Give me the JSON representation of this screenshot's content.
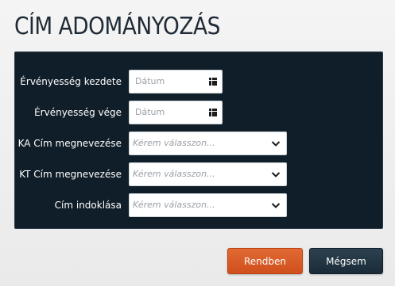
{
  "dialog": {
    "title": "CÍM ADOMÁNYOZÁS"
  },
  "form": {
    "validity_start": {
      "label": "Érvényesség kezdete",
      "placeholder": "Dátum",
      "icon": "calendar-grid-icon"
    },
    "validity_end": {
      "label": "Érvényesség vége",
      "placeholder": "Dátum",
      "icon": "calendar-grid-icon"
    },
    "ka_title_name": {
      "label": "KA Cím megnevezése",
      "placeholder": "Kérem válasszon...",
      "icon": "chevron-down-icon"
    },
    "kt_title_name": {
      "label": "KT Cím megnevezése",
      "placeholder": "Kérem válasszon...",
      "icon": "chevron-down-icon"
    },
    "title_reason": {
      "label": "Cím indoklása",
      "placeholder": "Kérem válasszon...",
      "icon": "chevron-down-icon"
    }
  },
  "buttons": {
    "ok_label": "Rendben",
    "cancel_label": "Mégsem"
  },
  "colors": {
    "panel_bg": "#101e29",
    "title_text": "#1e2a35",
    "ok_button": "#d8592a",
    "cancel_button": "#223544"
  }
}
